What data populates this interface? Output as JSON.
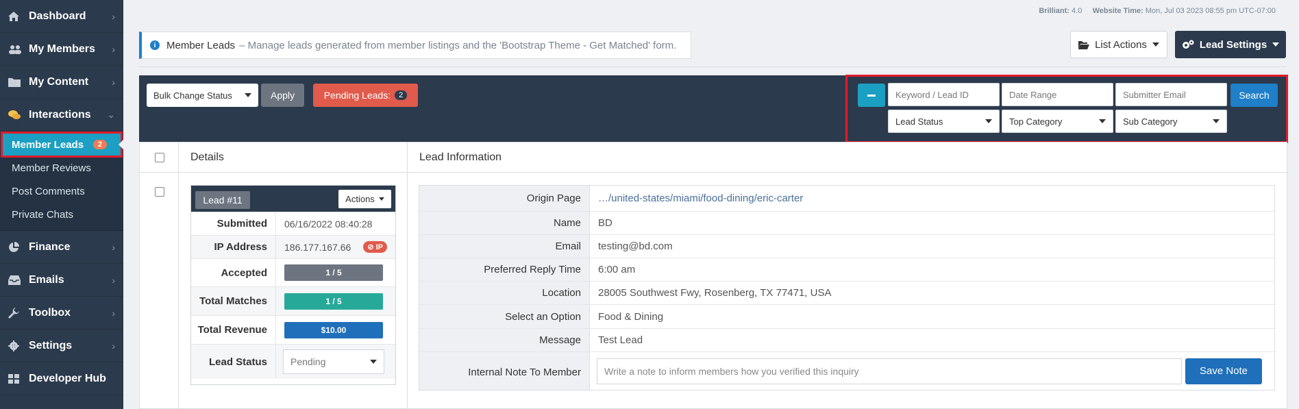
{
  "sidebar": {
    "items": [
      {
        "label": "Dashboard",
        "icon": "home-icon"
      },
      {
        "label": "My Members",
        "icon": "users-icon"
      },
      {
        "label": "My Content",
        "icon": "folder-icon"
      },
      {
        "label": "Interactions",
        "icon": "comments-icon"
      },
      {
        "label": "Finance",
        "icon": "pie-chart-icon"
      },
      {
        "label": "Emails",
        "icon": "inbox-icon"
      },
      {
        "label": "Toolbox",
        "icon": "wrench-icon"
      },
      {
        "label": "Settings",
        "icon": "gear-icon"
      },
      {
        "label": "Developer Hub",
        "icon": "grid-icon"
      }
    ],
    "sub_items": [
      {
        "label": "Member Leads",
        "badge": "2"
      },
      {
        "label": "Member Reviews"
      },
      {
        "label": "Post Comments"
      },
      {
        "label": "Private Chats"
      }
    ]
  },
  "topinfo": {
    "brand_label": "Brilliant:",
    "brand_value": "4.0",
    "time_label": "Website Time:",
    "time_value": "Mon, Jul 03 2023 08:55 pm UTC-07:00"
  },
  "header": {
    "title": "Member Leads",
    "description": "– Manage leads generated from member listings and the 'Bootstrap Theme - Get Matched' form.",
    "list_actions": "List Actions",
    "lead_settings": "Lead Settings"
  },
  "toolbar": {
    "bulk_status": "Bulk Change Status",
    "apply": "Apply",
    "pending_label": "Pending Leads:",
    "pending_count": "2",
    "keyword_placeholder": "Keyword / Lead ID",
    "date_placeholder": "Date Range",
    "email_placeholder": "Submitter Email",
    "search": "Search",
    "lead_status": "Lead Status",
    "top_category": "Top Category",
    "sub_category": "Sub Category"
  },
  "table": {
    "col_details": "Details",
    "col_info": "Lead Information"
  },
  "lead": {
    "tag": "Lead #11",
    "actions": "Actions",
    "submitted_label": "Submitted",
    "submitted": "06/16/2022 08:40:28",
    "ip_label": "IP Address",
    "ip": "186.177.167.66",
    "ip_badge": "⊘ IP",
    "accepted_label": "Accepted",
    "accepted": "1 / 5",
    "matches_label": "Total Matches",
    "matches": "1 / 5",
    "revenue_label": "Total Revenue",
    "revenue": "$10.00",
    "status_label": "Lead Status",
    "status": "Pending"
  },
  "info": {
    "rows": [
      {
        "label": "Origin Page",
        "value": "…/united-states/miami/food-dining/eric-carter"
      },
      {
        "label": "Name",
        "value": "BD"
      },
      {
        "label": "Email",
        "value": "testing@bd.com"
      },
      {
        "label": "Preferred Reply Time",
        "value": "6:00 am"
      },
      {
        "label": "Location",
        "value": "28005 Southwest Fwy, Rosenberg, TX 77471, USA"
      },
      {
        "label": "Select an Option",
        "value": "Food & Dining"
      },
      {
        "label": "Message",
        "value": "Test Lead"
      }
    ],
    "note_label": "Internal Note To Member",
    "note_placeholder": "Write a note to inform members how you verified this inquiry",
    "save_note": "Save Note"
  },
  "colors": {
    "sidebar": "#2b3a4c",
    "accent": "#1b9fc2",
    "primary": "#1f7fc9",
    "danger": "#e05b4b",
    "teal": "#27a99a",
    "highlight": "#e21b2c"
  }
}
